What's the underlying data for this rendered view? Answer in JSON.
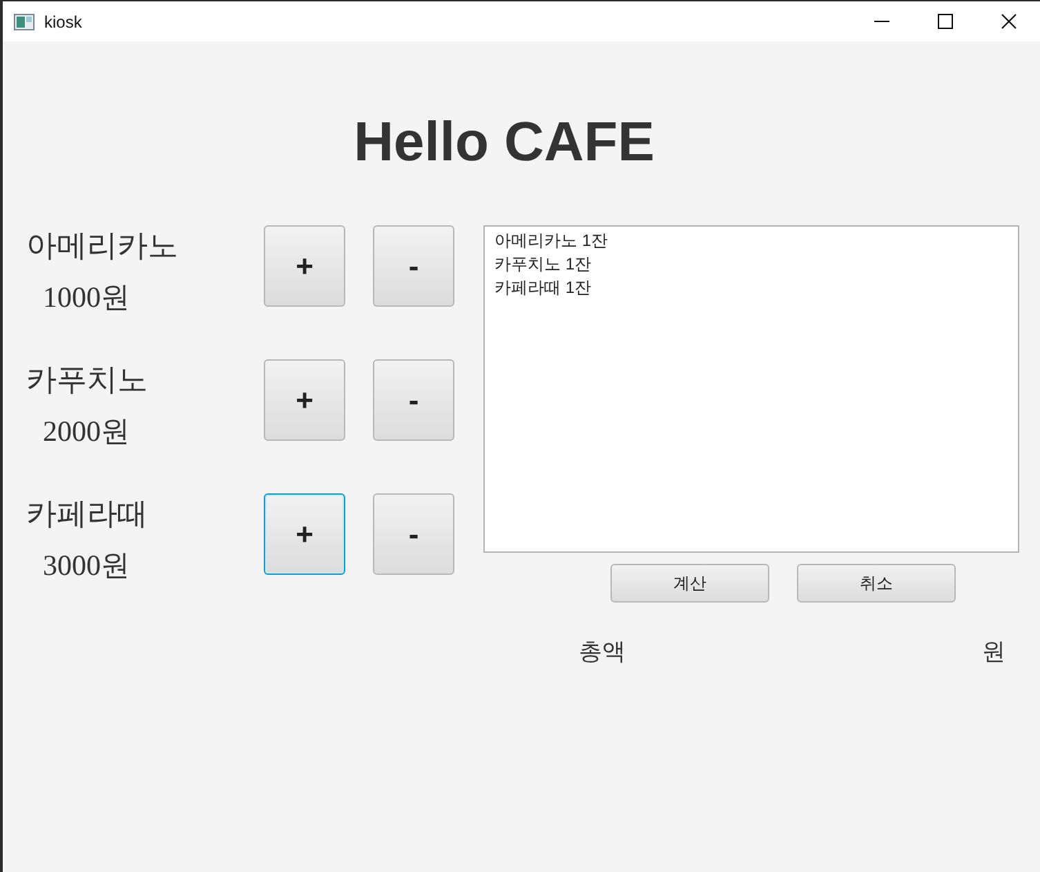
{
  "window": {
    "title": "kiosk"
  },
  "heading": "Hello CAFE",
  "menu": [
    {
      "name": "아메리카노",
      "price": "1000원",
      "plus": {
        "label": "+",
        "focused": false
      },
      "minus": {
        "label": "-"
      }
    },
    {
      "name": "카푸치노",
      "price": "2000원",
      "plus": {
        "label": "+",
        "focused": false
      },
      "minus": {
        "label": "-"
      }
    },
    {
      "name": "카페라때",
      "price": "3000원",
      "plus": {
        "label": "+",
        "focused": true
      },
      "minus": {
        "label": "-"
      }
    }
  ],
  "order_list": [
    "아메리카노 1잔",
    "카푸치노 1잔",
    "카페라때 1잔"
  ],
  "buttons": [
    "계산",
    "취소"
  ],
  "total": {
    "label": "총액",
    "unit": "원"
  }
}
